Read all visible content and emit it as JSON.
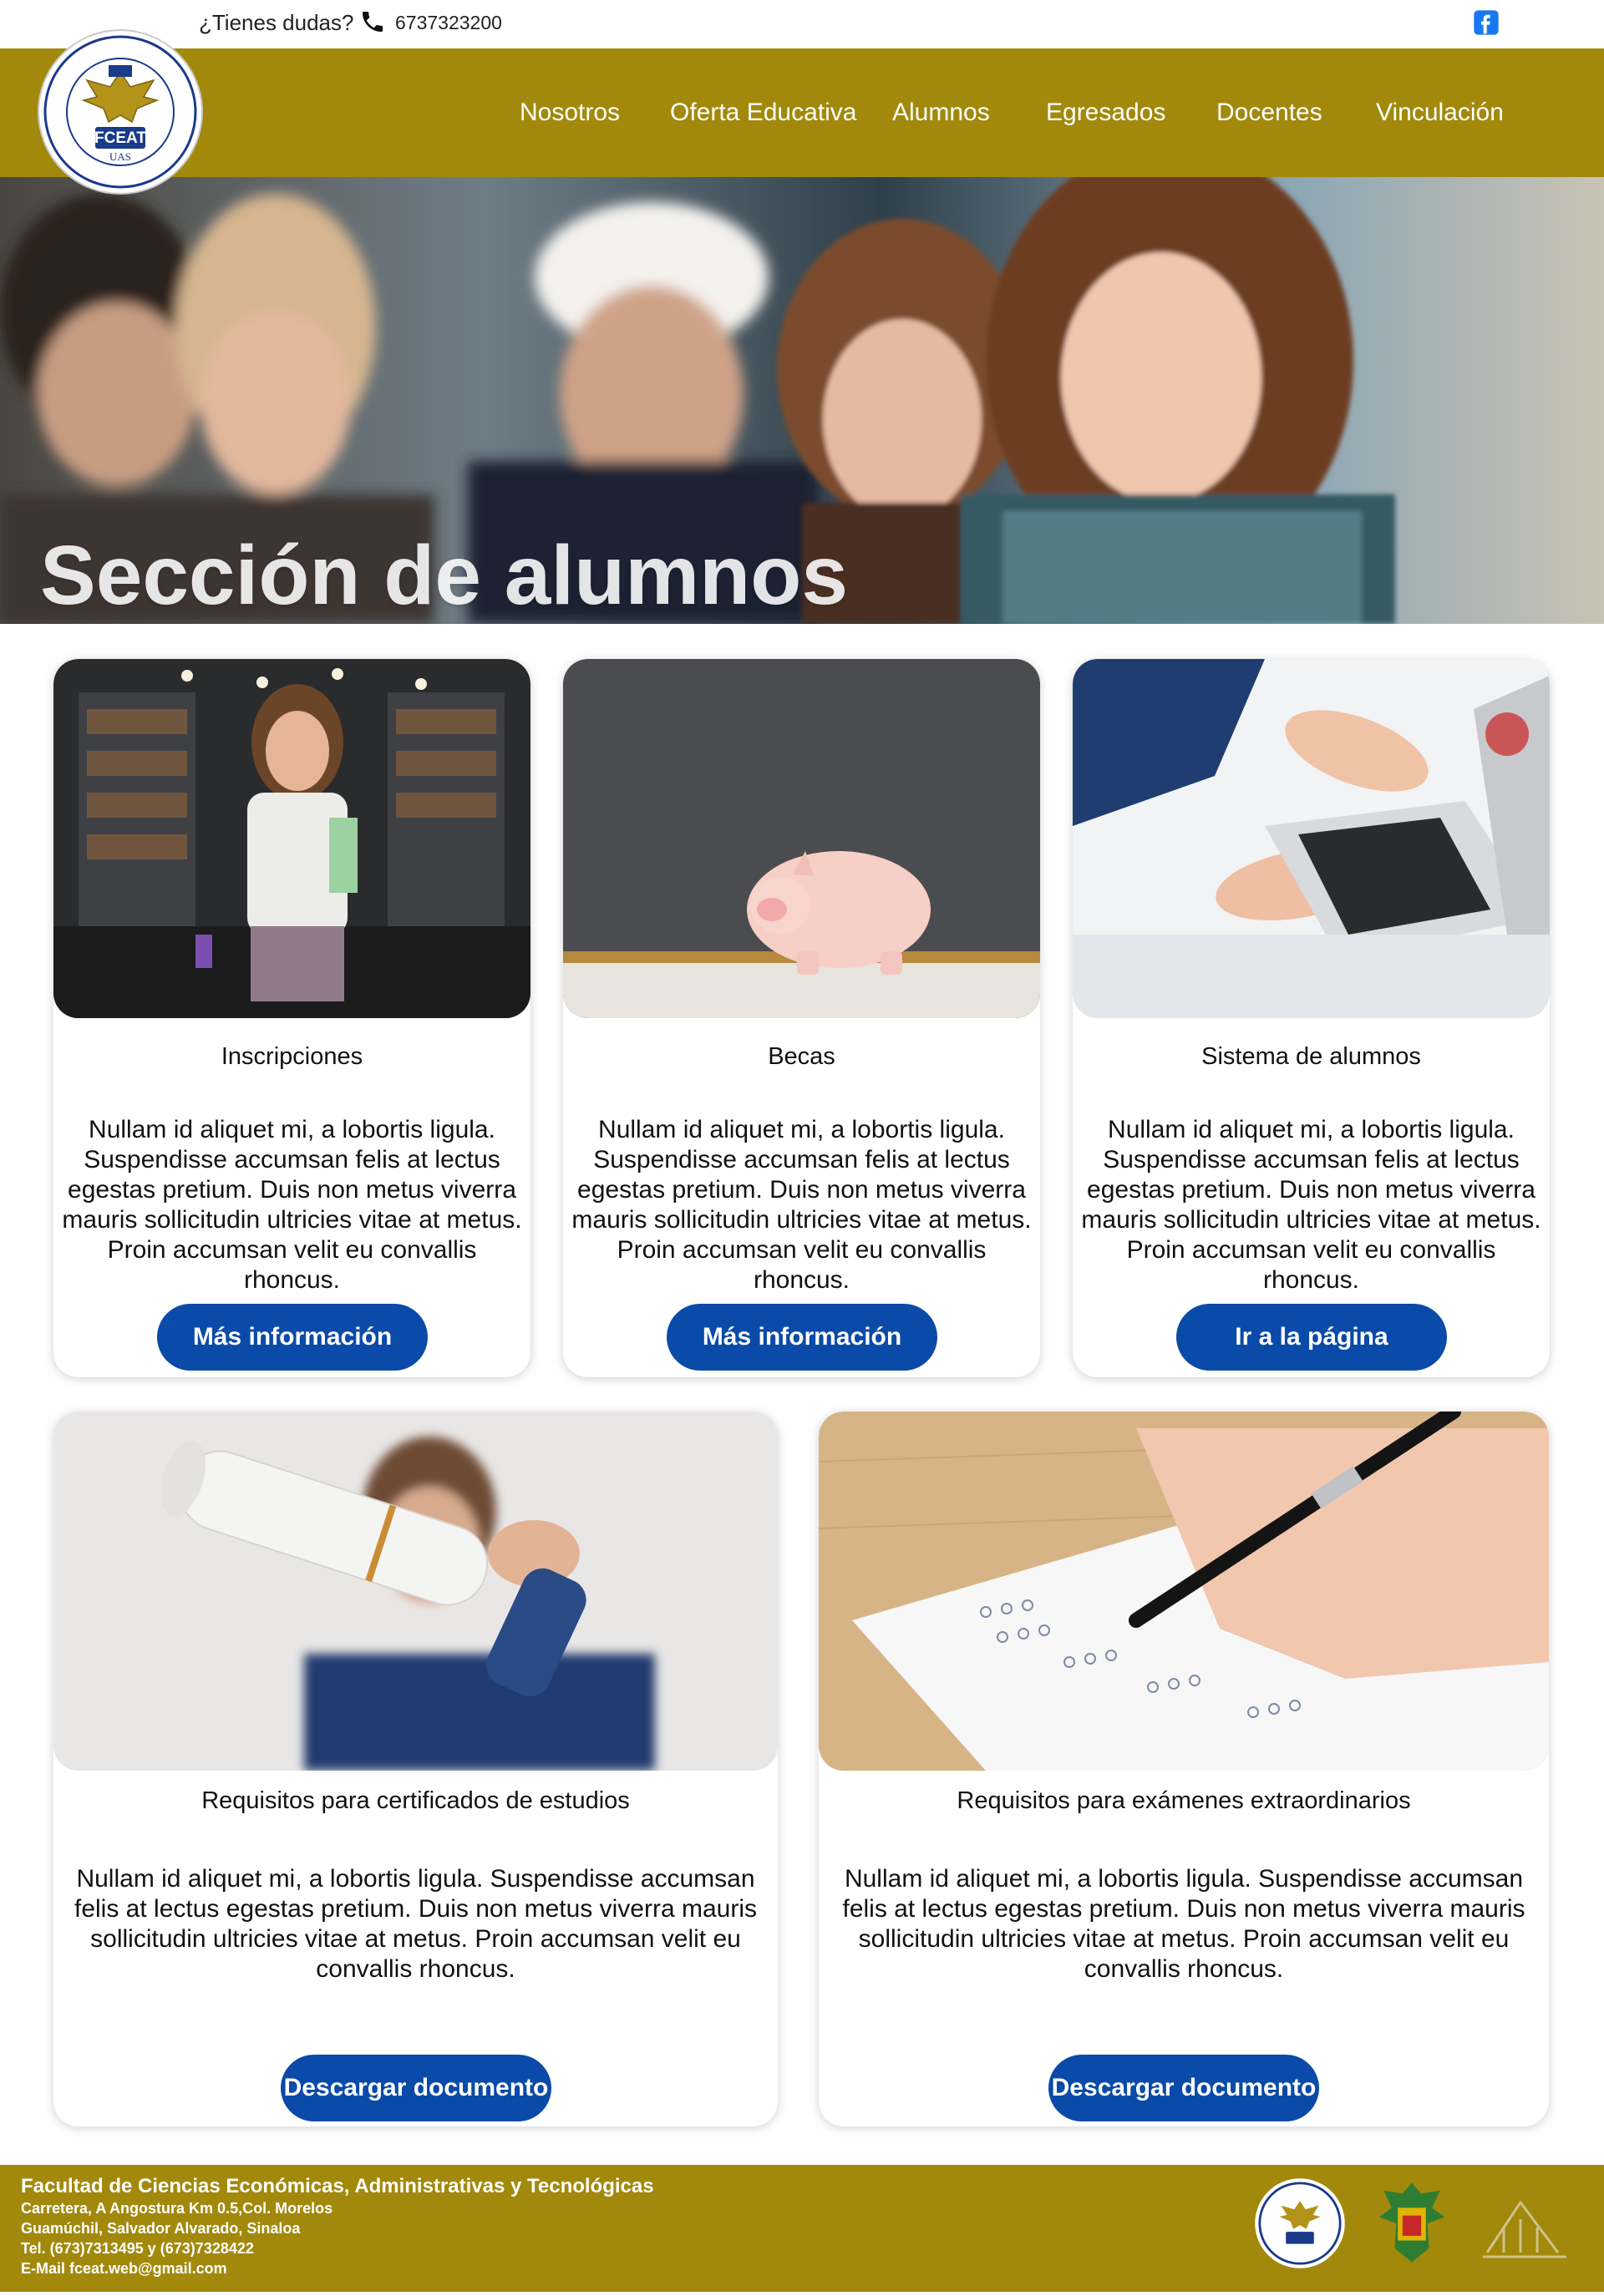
{
  "topbar": {
    "question": "¿Tienes dudas?",
    "phone": "6737323200",
    "phone_icon": "phone-icon",
    "social_icon": "facebook-icon"
  },
  "brand": {
    "logo_text": "FCEAT",
    "logo_sub": "UAS",
    "accent": "#a2890c",
    "button_color": "#0a4aa8"
  },
  "nav": {
    "items": [
      {
        "label": "Nosotros"
      },
      {
        "label": "Oferta Educativa"
      },
      {
        "label": "Alumnos"
      },
      {
        "label": "Egresados"
      },
      {
        "label": "Docentes"
      },
      {
        "label": "Vinculación"
      }
    ]
  },
  "hero": {
    "title": "Sección de alumnos"
  },
  "cards": [
    {
      "title": "Inscripciones",
      "text": "Nullam id aliquet mi, a lobortis ligula. Suspendisse accumsan felis at lectus egestas pretium. Duis non metus viverra mauris sollicitudin ultricies vitae at metus. Proin accumsan velit eu convallis rhoncus.",
      "button": "Más información"
    },
    {
      "title": "Becas",
      "text": "Nullam id aliquet mi, a lobortis ligula. Suspendisse accumsan felis at lectus egestas pretium. Duis non metus viverra mauris sollicitudin ultricies vitae at metus. Proin accumsan velit eu convallis rhoncus.",
      "button": "Más información"
    },
    {
      "title": "Sistema de alumnos",
      "text": "Nullam id aliquet mi, a lobortis ligula. Suspendisse accumsan felis at lectus egestas pretium. Duis non metus viverra mauris sollicitudin ultricies vitae at metus. Proin accumsan velit eu convallis rhoncus.",
      "button": "Ir a la página"
    },
    {
      "title": "Requisitos para certificados de estudios",
      "text": "Nullam id aliquet mi, a lobortis ligula. Suspendisse accumsan felis at lectus egestas pretium. Duis non metus viverra mauris sollicitudin ultricies vitae at metus. Proin accumsan velit eu convallis rhoncus.",
      "button": "Descargar documento"
    },
    {
      "title": "Requisitos para exámenes extraordinarios",
      "text": "Nullam id aliquet mi, a lobortis ligula. Suspendisse accumsan felis at lectus egestas pretium. Duis non metus viverra mauris sollicitudin ultricies vitae at metus. Proin accumsan velit eu convallis rhoncus.",
      "button": "Descargar documento"
    }
  ],
  "footer": {
    "title": "Facultad de Ciencias Económicas, Administrativas y Tecnológicas",
    "lines": [
      "Carretera, A Angostura Km 0.5,Col. Morelos",
      "Guamúchil, Salvador Alvarado, Sinaloa",
      "Tel. (673)7313495 y (673)7328422",
      "E-Mail fceat.web@gmail.com"
    ],
    "logos": [
      "fceat-logo",
      "uas-logo",
      "global-logo"
    ]
  }
}
